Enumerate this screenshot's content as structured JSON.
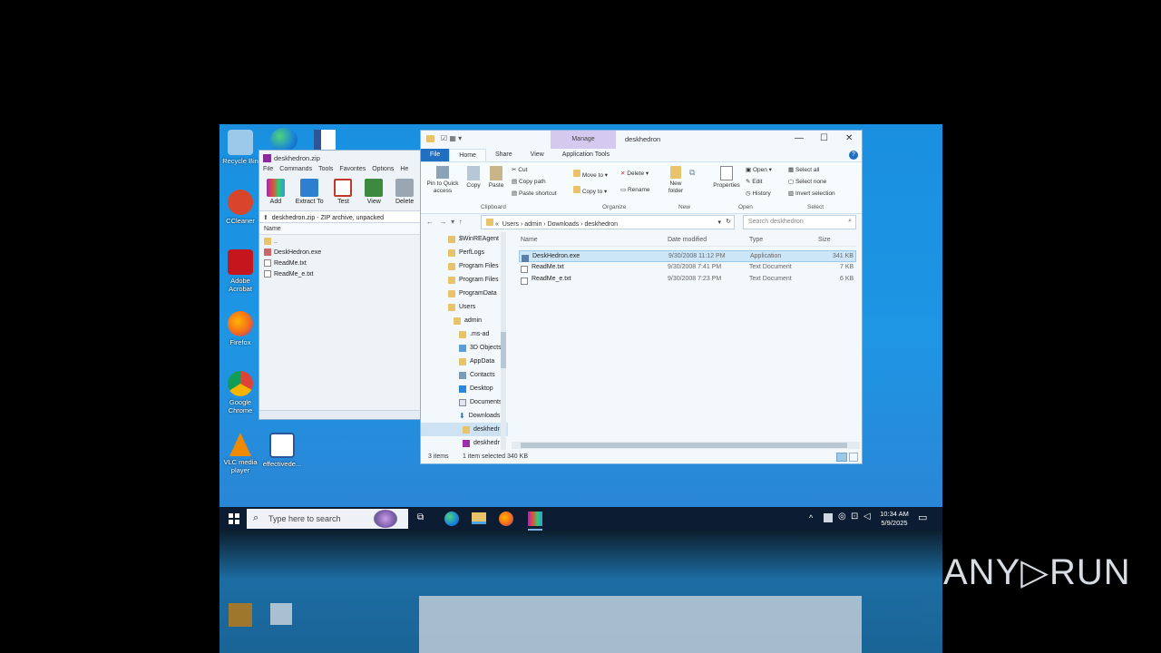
{
  "desktop": {
    "icons": [
      {
        "label": "Recycle Bin",
        "color": "#9cc9ea"
      },
      {
        "label": "CCleaner",
        "color": "#d9452b"
      },
      {
        "label": "Adobe Acrobat",
        "color": "#c4161c"
      },
      {
        "label": "Firefox",
        "color": "#f46b1c"
      },
      {
        "label": "Google Chrome",
        "color": "#2f9d4a"
      },
      {
        "label": "VLC media player",
        "color": "#f08a00"
      },
      {
        "label": "effectivede...",
        "color": "#2b5797"
      }
    ]
  },
  "winrar": {
    "title": "deskhedron.zip",
    "menu": [
      "File",
      "Commands",
      "Tools",
      "Favorites",
      "Options",
      "He"
    ],
    "toolbar": [
      "Add",
      "Extract To",
      "Test",
      "View",
      "Delete"
    ],
    "address": "deskhedron.zip - ZIP archive, unpacked",
    "column_name": "Name",
    "rows": [
      "..",
      "DeskHedron.exe",
      "ReadMe.txt",
      "ReadMe_e.txt"
    ]
  },
  "explorer": {
    "title": "deskhedron",
    "manage_tab": "Manage",
    "tabs": [
      "File",
      "Home",
      "Share",
      "View",
      "Application Tools"
    ],
    "ribbon": {
      "pin": "Pin to Quick access",
      "copy": "Copy",
      "paste": "Paste",
      "cut": "Cut",
      "copy_path": "Copy path",
      "paste_shortcut": "Paste shortcut",
      "move_to": "Move to",
      "copy_to": "Copy to",
      "delete": "Delete",
      "rename": "Rename",
      "new_folder": "New folder",
      "properties": "Properties",
      "open": "Open",
      "edit": "Edit",
      "history": "History",
      "select_all": "Select all",
      "select_none": "Select none",
      "invert_selection": "Invert selection",
      "groups": [
        "Clipboard",
        "Organize",
        "New",
        "Open",
        "Select"
      ]
    },
    "breadcrumb": [
      "«",
      "Users",
      "admin",
      "Downloads",
      "deskhedron"
    ],
    "search_placeholder": "Search deskhedron",
    "tree": [
      "$WinREAgent",
      "PerfLogs",
      "Program Files",
      "Program Files",
      "ProgramData",
      "Users",
      "admin",
      ".ms-ad",
      "3D Objects",
      "AppData",
      "Contacts",
      "Desktop",
      "Documents",
      "Downloads",
      "deskhedr",
      "deskhedr"
    ],
    "columns": [
      "Name",
      "Date modified",
      "Type",
      "Size"
    ],
    "files": [
      {
        "name": "DeskHedron.exe",
        "date": "9/30/2008 11:12 PM",
        "type": "Application",
        "size": "341 KB"
      },
      {
        "name": "ReadMe.txt",
        "date": "9/30/2008 7:41 PM",
        "type": "Text Document",
        "size": "7 KB"
      },
      {
        "name": "ReadMe_e.txt",
        "date": "9/30/2008 7:23 PM",
        "type": "Text Document",
        "size": "6 KB"
      }
    ],
    "status_items": "3 items",
    "status_selected": "1 item selected  340 KB"
  },
  "taskbar": {
    "search_text": "Type here to search",
    "time": "10:34 AM",
    "date": "5/9/2025"
  },
  "watermark": "ANY▷RUN"
}
